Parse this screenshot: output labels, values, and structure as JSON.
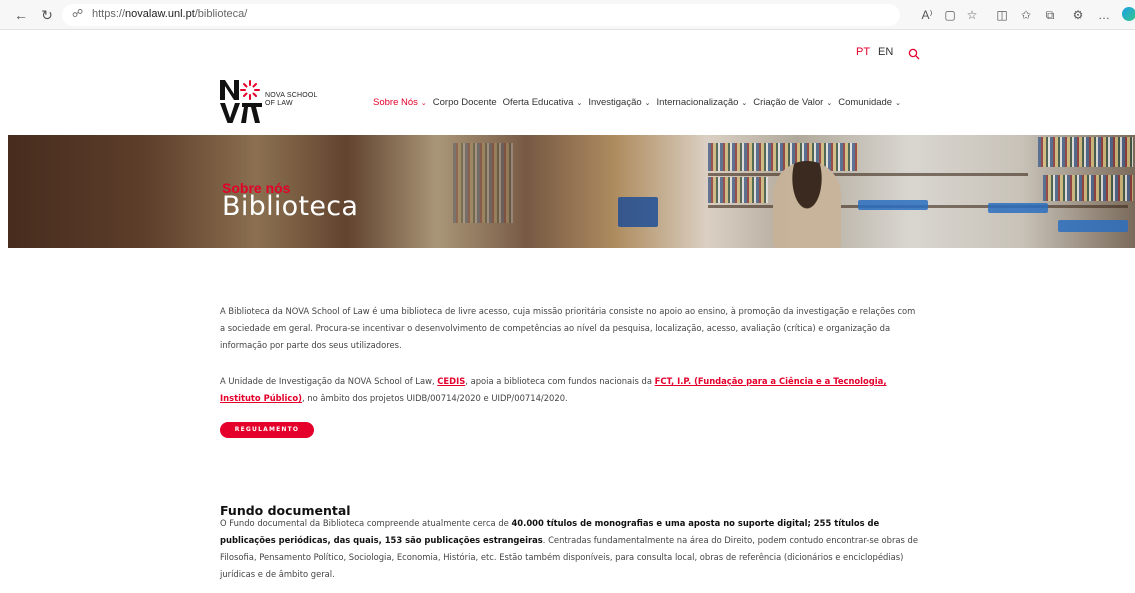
{
  "browser": {
    "url_prefix": "https://",
    "url_domain": "novalaw.unl.pt",
    "url_path": "/biblioteca/",
    "read_aloud_label": "A⁾",
    "more_label": "…"
  },
  "lang": {
    "pt": "PT",
    "en": "EN"
  },
  "logo": {
    "line1": "NOVA SCHOOL",
    "line2": "OF LAW"
  },
  "nav": [
    {
      "label": "Sobre Nós",
      "active": true
    },
    {
      "label": "Corpo Docente",
      "active": false
    },
    {
      "label": "Oferta Educativa",
      "active": false
    },
    {
      "label": "Investigação",
      "active": false
    },
    {
      "label": "Internacionalização",
      "active": false
    },
    {
      "label": "Criação de Valor",
      "active": false
    },
    {
      "label": "Comunidade",
      "active": false
    }
  ],
  "hero": {
    "overline": "Sobre nós",
    "title": "Biblioteca"
  },
  "content": {
    "p1": "A Biblioteca da NOVA School of Law é uma biblioteca de livre acesso, cuja missão prioritária consiste no apoio ao ensino, à promoção da investigação e relações com a sociedade em geral. Procura-se incentivar o desenvolvimento de competências ao nível da pesquisa, localização, acesso, avaliação (crítica) e organização da informação por parte dos seus utilizadores.",
    "p2_a": "A Unidade de Investigação da NOVA School of Law, ",
    "p2_link1": "CEDIS",
    "p2_b": ", apoia a biblioteca com fundos nacionais da ",
    "p2_link2": "FCT, I.P. (Fundação para a Ciência e a Tecnologia, Instituto Público)",
    "p2_c": ", no âmbito dos projetos UIDB/00714/2020 e UIDP/00714/2020.",
    "button": "REGULAMENTO",
    "section_title": "Fundo documental",
    "p3_a": "O Fundo documental da Biblioteca compreende atualmente cerca de ",
    "p3_b1": "40.000 títulos de monografias e uma aposta no suporte digital; 255 títulos de publicações periódicas, das quais, 153 são publicações estrangeiras",
    "p3_c": ". Centradas fundamentalmente na área do Direito, podem contudo encontrar-se obras de Filosofia, Pensamento Político, Sociologia, Economia, História, etc. Estão também disponíveis, para consulta local, obras de referência (dicionários e enciclopédias) jurídicas e de âmbito geral."
  },
  "colors": {
    "accent": "#e4002b",
    "text": "#444444"
  }
}
